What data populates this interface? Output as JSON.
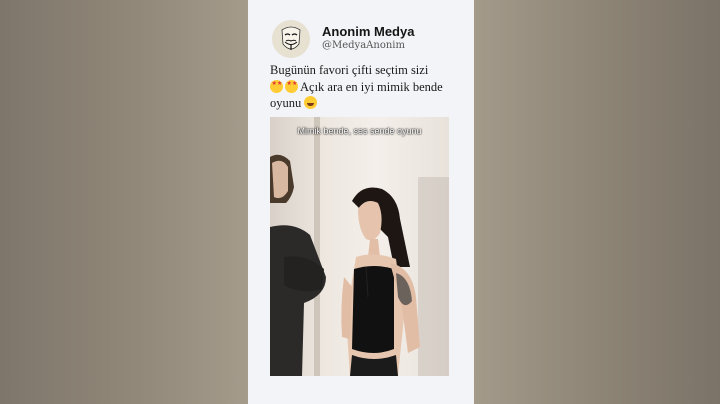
{
  "post": {
    "author_name": "Anonim Medya",
    "author_handle": "@MedyaAnonim",
    "text_line1": "Bugünün favori çifti seçtim sizi",
    "text_line2": "Açık ara en iyi mimik bende",
    "text_line3": "oyunu",
    "emojis": [
      "star-struck-emoji",
      "star-struck-emoji",
      "laughing-emoji"
    ]
  },
  "video": {
    "caption": "Mimik bende, ses sende oyunu"
  },
  "colors": {
    "card_background": "#f3f4f8",
    "side_blur": "#8f8679"
  }
}
